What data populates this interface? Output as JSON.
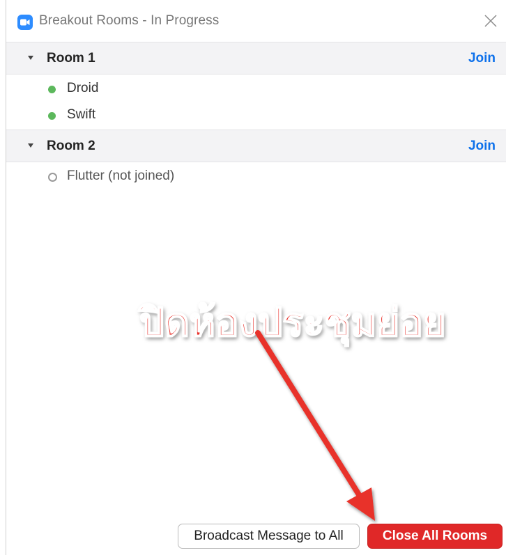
{
  "window": {
    "title": "Breakout Rooms - In Progress",
    "app_icon": "zoom-camera-icon",
    "close_icon": "close-icon"
  },
  "rooms": [
    {
      "name": "Room 1",
      "join_label": "Join",
      "participants": [
        {
          "name": "Droid",
          "status": "joined"
        },
        {
          "name": "Swift",
          "status": "joined"
        }
      ]
    },
    {
      "name": "Room 2",
      "join_label": "Join",
      "participants": [
        {
          "name": "Flutter (not joined)",
          "status": "not-joined"
        }
      ]
    }
  ],
  "footer": {
    "broadcast_label": "Broadcast Message to All",
    "close_all_label": "Close All Rooms"
  },
  "annotation": {
    "text": "ปิดห้องประชุมย่อย",
    "color": "#e8312b"
  },
  "colors": {
    "accent": "#0e71eb",
    "danger": "#e02828",
    "joined_dot": "#5cb85c",
    "zoom_blue": "#2d8cff"
  }
}
